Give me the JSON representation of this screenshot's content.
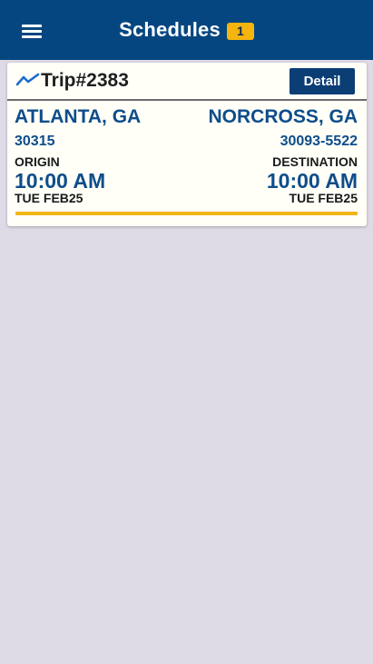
{
  "appbar": {
    "title": "Schedules",
    "badge_count": "1",
    "menu_icon": "hamburger-menu-icon",
    "color": "#064680",
    "badge_color": "#f6b40e"
  },
  "trip": {
    "icon": "trend-line-icon",
    "title": "Trip#2383",
    "detail_label": "Detail",
    "origin": {
      "city": "ATLANTA, GA",
      "zip": "30315",
      "label": "ORIGIN",
      "time": "10:00 AM",
      "date": "TUE FEB25"
    },
    "destination": {
      "city": "NORCROSS, GA",
      "zip": "30093-5522",
      "label": "DESTINATION",
      "time": "10:00 AM",
      "date": "TUE FEB25"
    },
    "accent_color": "#f1b517"
  }
}
